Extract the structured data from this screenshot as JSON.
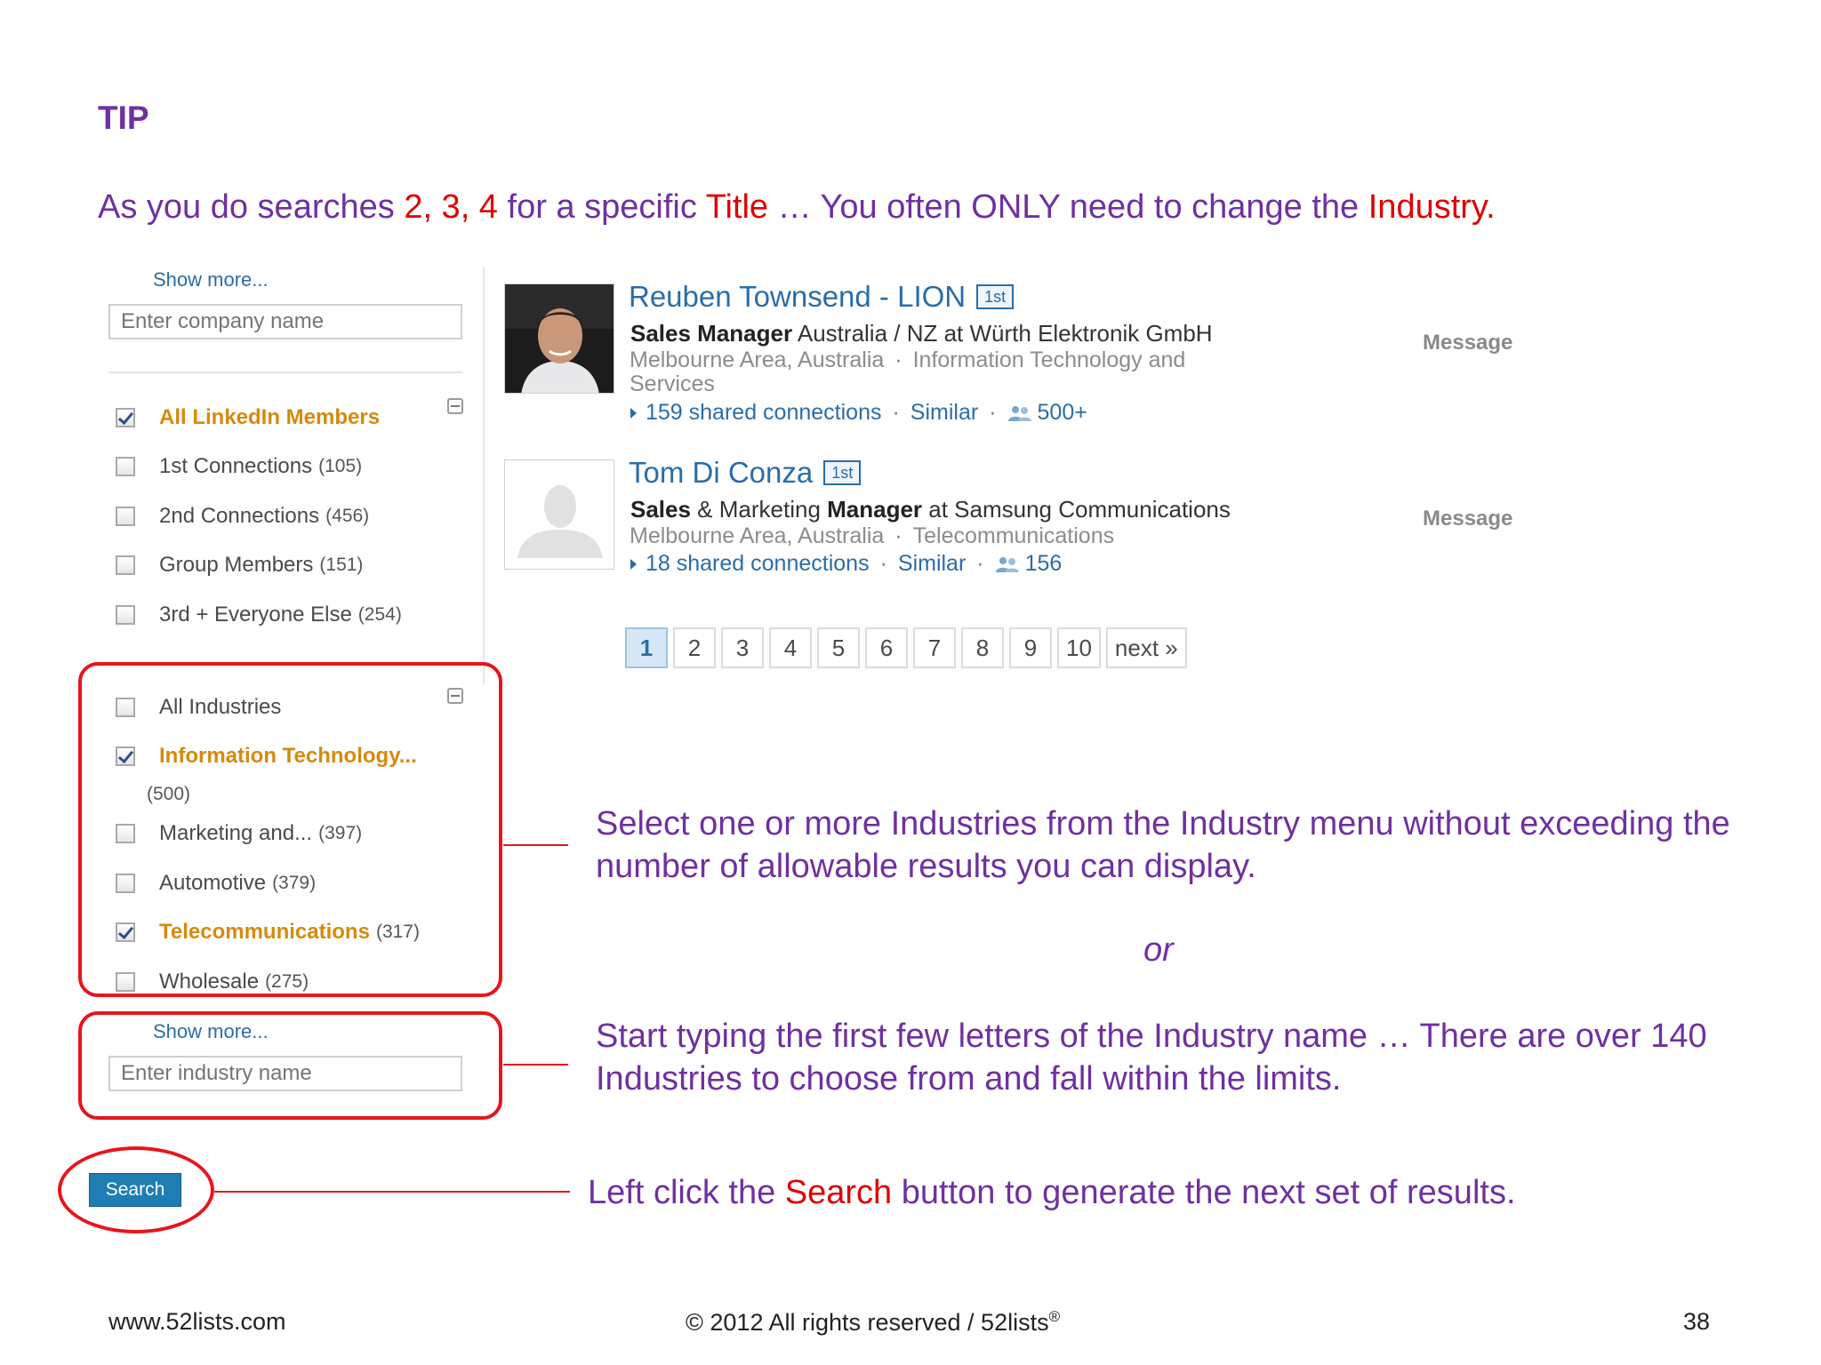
{
  "heading": "TIP",
  "intro": {
    "p1": "As you do searches ",
    "p2": "2, 3, 4",
    "p3": " for a specific ",
    "p4": "Title",
    "p5": " … You often ONLY need to change the ",
    "p6": "Industry."
  },
  "company_filter": {
    "show_more": "Show more...",
    "placeholder": "Enter company name"
  },
  "relationship_filter": [
    {
      "label": "All LinkedIn Members",
      "count": "",
      "checked": true
    },
    {
      "label": "1st Connections",
      "count": "(105)",
      "checked": false
    },
    {
      "label": "2nd Connections",
      "count": "(456)",
      "checked": false
    },
    {
      "label": "Group Members",
      "count": "(151)",
      "checked": false
    },
    {
      "label": "3rd + Everyone Else",
      "count": "(254)",
      "checked": false
    }
  ],
  "industry_filter": {
    "items": [
      {
        "label": "All Industries",
        "count": "",
        "checked": false
      },
      {
        "label": "Information Technology...",
        "count": "(500)",
        "checked": true
      },
      {
        "label": "Marketing and...",
        "count": "(397)",
        "checked": false
      },
      {
        "label": "Automotive",
        "count": "(379)",
        "checked": false
      },
      {
        "label": "Telecommunications",
        "count": "(317)",
        "checked": true
      },
      {
        "label": "Wholesale",
        "count": "(275)",
        "checked": false
      }
    ],
    "show_more": "Show more...",
    "placeholder": "Enter industry name"
  },
  "search_button": "Search",
  "results": [
    {
      "name": "Reuben Townsend - LION",
      "degree": "1st",
      "title_bold": "Sales Manager",
      "title_rest": " Australia / NZ at Würth Elektronik GmbH",
      "location": "Melbourne Area, Australia",
      "industry": "Information Technology and Services",
      "shared": "159 shared connections",
      "similar": "Similar",
      "connections": "500+",
      "message": "Message"
    },
    {
      "name": "Tom Di Conza",
      "degree": "1st",
      "title_bold1": "Sales",
      "title_mid": " & Marketing ",
      "title_bold2": "Manager",
      "title_rest": " at Samsung Communications",
      "location": "Melbourne Area, Australia",
      "industry": "Telecommunications",
      "shared": "18 shared connections",
      "similar": "Similar",
      "connections": "156",
      "message": "Message"
    }
  ],
  "pagination": [
    "1",
    "2",
    "3",
    "4",
    "5",
    "6",
    "7",
    "8",
    "9",
    "10",
    "next »"
  ],
  "notes": {
    "industry_menu": "Select one or more Industries from the Industry menu without exceeding the number of allowable results you can display.",
    "or": "or",
    "typing": "Start typing the first few letters of the Industry name … There are over 140 Industries to choose from and fall within the limits.",
    "search_p1": "Left click the ",
    "search_p2": "Search",
    "search_p3": " button to generate the next set of results."
  },
  "footer": {
    "website": "www.52lists.com",
    "copyright": "© 2012 All rights reserved / 52lists",
    "registered_mark": "®",
    "page_number": "38"
  },
  "colors": {
    "accent_purple": "#7030a0",
    "highlight_red": "#e00000",
    "link_blue": "#2a6da8",
    "selected_orange": "#d68a0c"
  }
}
